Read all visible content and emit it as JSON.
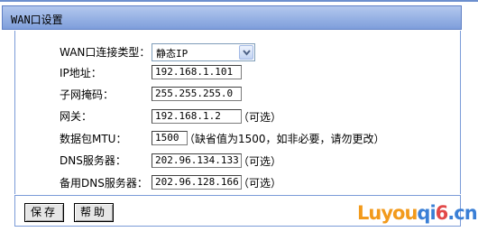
{
  "header": {
    "title": "WAN口设置"
  },
  "form": {
    "wan_type": {
      "label": "WAN口连接类型：",
      "value": "静态IP"
    },
    "ip": {
      "label": "IP地址：",
      "value": "192.168.1.101"
    },
    "mask": {
      "label": "子网掩码：",
      "value": "255.255.255.0"
    },
    "gateway": {
      "label": "网关：",
      "value": "192.168.1.2",
      "hint": "（可选）"
    },
    "mtu": {
      "label": "数据包MTU：",
      "value": "1500",
      "hint": "（缺省值为1500，如非必要，请勿更改）"
    },
    "dns": {
      "label": "DNS服务器：",
      "value": "202.96.134.133",
      "hint": "（可选）"
    },
    "dns2": {
      "label": "备用DNS服务器：",
      "value": "202.96.128.166",
      "hint": "（可选）"
    }
  },
  "buttons": {
    "save": "保存",
    "help": "帮助"
  },
  "watermark": {
    "part1": "Lu",
    "part2": "you",
    "part3": "qi",
    "part4": "6",
    "part5": ".cn"
  },
  "colors": {
    "header_bg": "#8fabe2",
    "border": "#7b9bd8",
    "watermark_orange": "#f29a1c",
    "watermark_blue": "#3a7fd6",
    "watermark_red": "#e24848"
  }
}
